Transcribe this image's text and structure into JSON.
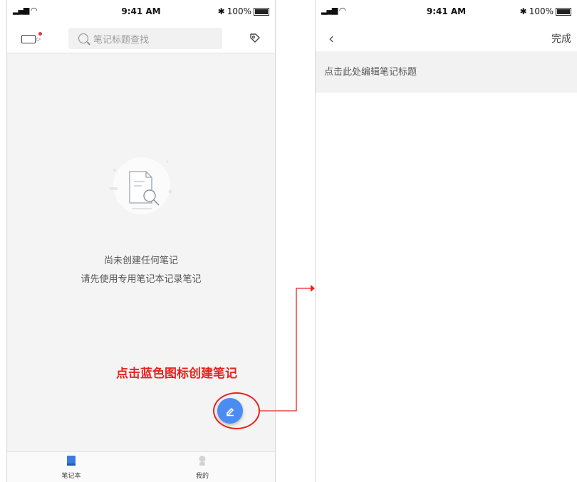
{
  "left_screen": {
    "status_bar": {
      "time": "9:41 AM",
      "battery": "100%"
    },
    "search": {
      "placeholder": "笔记标题查找"
    },
    "empty_state": {
      "line1": "尚未创建任何笔记",
      "line2": "请先使用专用笔记本记录笔记"
    },
    "tabs": [
      {
        "label": "笔记本",
        "icon": "notebook-icon"
      },
      {
        "label": "我的",
        "icon": "profile-icon"
      }
    ]
  },
  "annotation": {
    "callout_text": "点击蓝色图标创建笔记",
    "color": "#e8231f"
  },
  "right_screen": {
    "status_bar": {
      "time": "9:41 AM",
      "battery": "100%"
    },
    "nav": {
      "done_label": "完成"
    },
    "title_placeholder": "点击此处编辑笔记标题"
  },
  "colors": {
    "accent": "#4a8cf2",
    "annotation_red": "#e8231f",
    "background": "#f4f4f4"
  }
}
